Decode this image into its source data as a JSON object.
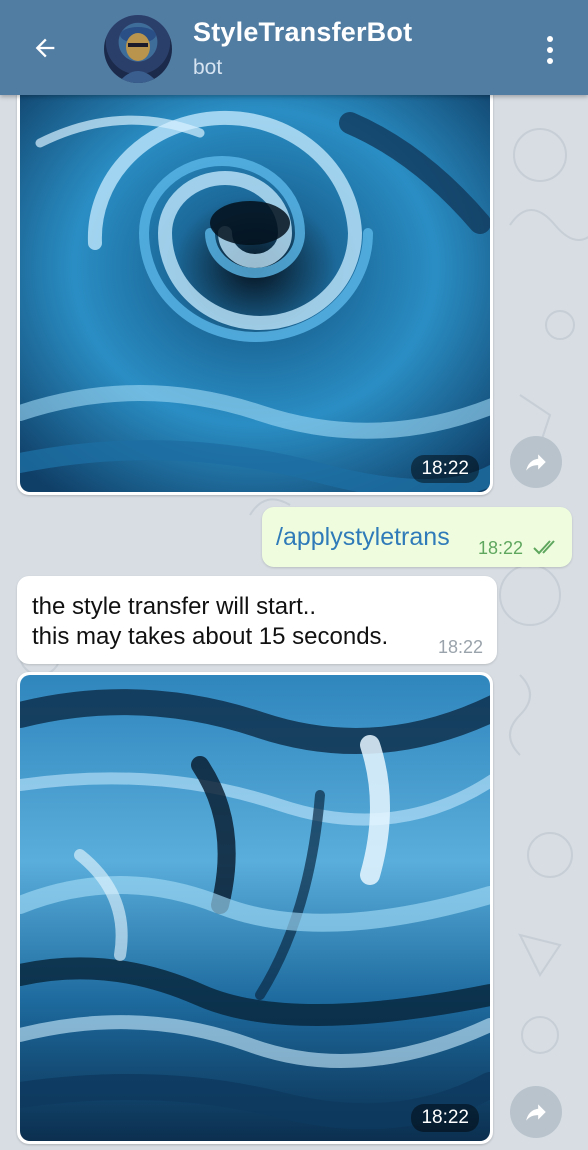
{
  "header": {
    "title": "StyleTransferBot",
    "subtitle": "bot",
    "back_icon": "arrow-left-icon",
    "menu_icon": "more-vertical-icon",
    "color": "#527da3"
  },
  "chat": {
    "background": "#d7dde3",
    "messages": [
      {
        "type": "photo",
        "from": "bot",
        "time": "18:22"
      },
      {
        "type": "text",
        "from": "user",
        "text": "/applystyletrans",
        "time": "18:22",
        "status": "read"
      },
      {
        "type": "text",
        "from": "bot",
        "lines": [
          "the style transfer will start..",
          "this may takes about 15 seconds."
        ],
        "time": "18:22"
      },
      {
        "type": "photo",
        "from": "bot",
        "time": "18:22"
      }
    ],
    "share_icon": "share-arrow-icon",
    "outgoing_bubble_color": "#effdde",
    "link_color": "#2f7ab8",
    "read_check_color": "#5fa65f"
  }
}
